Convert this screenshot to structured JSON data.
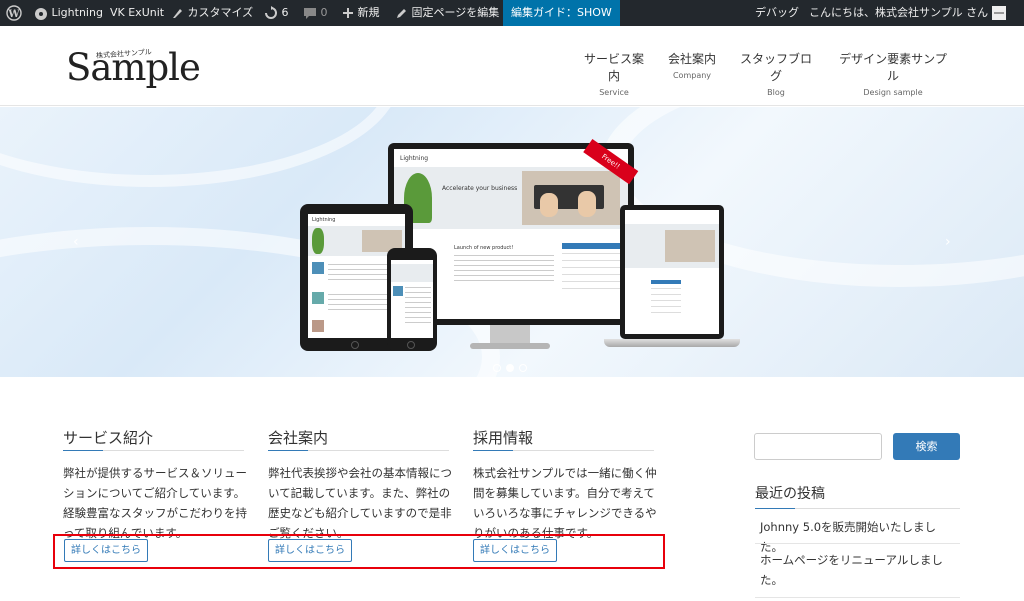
{
  "adminbar": {
    "site_name": "Lightning",
    "vk_exunit": "VK ExUnit",
    "customize": "カスタマイズ",
    "updates_count": "6",
    "comments_count": "0",
    "new_label": "新規",
    "edit_page": "固定ページを編集",
    "guide": "編集ガイド：SHOW",
    "debug": "デバッグ",
    "greeting": "こんにちは、株式会社サンプル さん"
  },
  "header": {
    "logo_small": "株式会社サンプル",
    "logo_main": "Sample",
    "nav": [
      {
        "ja": "サービス案内",
        "en": "Service"
      },
      {
        "ja": "会社案内",
        "en": "Company"
      },
      {
        "ja": "スタッフブログ",
        "en": "Blog"
      },
      {
        "ja": "デザイン要素サンプル",
        "en": "Design sample"
      }
    ]
  },
  "slider": {
    "arrow_prev": "‹",
    "arrow_next": "›",
    "active_slide": 2,
    "slide_count": 3,
    "mock": {
      "brand": "Lightning",
      "headline": "Accelerate your business",
      "post_title": "Launch of new product!",
      "ribbon": "Free!!"
    }
  },
  "columns": [
    {
      "title": "サービス紹介",
      "text": "弊社が提供するサービス＆ソリューションについてご紹介しています。経験豊富なスタッフがこだわりを持って取り組んでいます。",
      "button": "詳しくはこちら"
    },
    {
      "title": "会社案内",
      "text": "弊社代表挨拶や会社の基本情報について記載しています。また、弊社の歴史なども紹介していますので是非ご覧ください。",
      "button": "詳しくはこちら"
    },
    {
      "title": "採用情報",
      "text": "株式会社サンプルでは一緒に働く仲間を募集しています。自分で考えていろいろな事にチャレンジできるやりがいのある仕事です。",
      "button": "詳しくはこちら"
    }
  ],
  "sidebar": {
    "search_button": "検索",
    "search_placeholder": "",
    "recent_title": "最近の投稿",
    "posts": [
      "Johnny 5.0を販売開始いたしました。",
      "ホームページをリニューアルしました。"
    ]
  },
  "colors": {
    "accent": "#337ab7",
    "adminbar_bg": "#23282d",
    "guide_bg": "#0073aa",
    "highlight": "#e8000b"
  }
}
